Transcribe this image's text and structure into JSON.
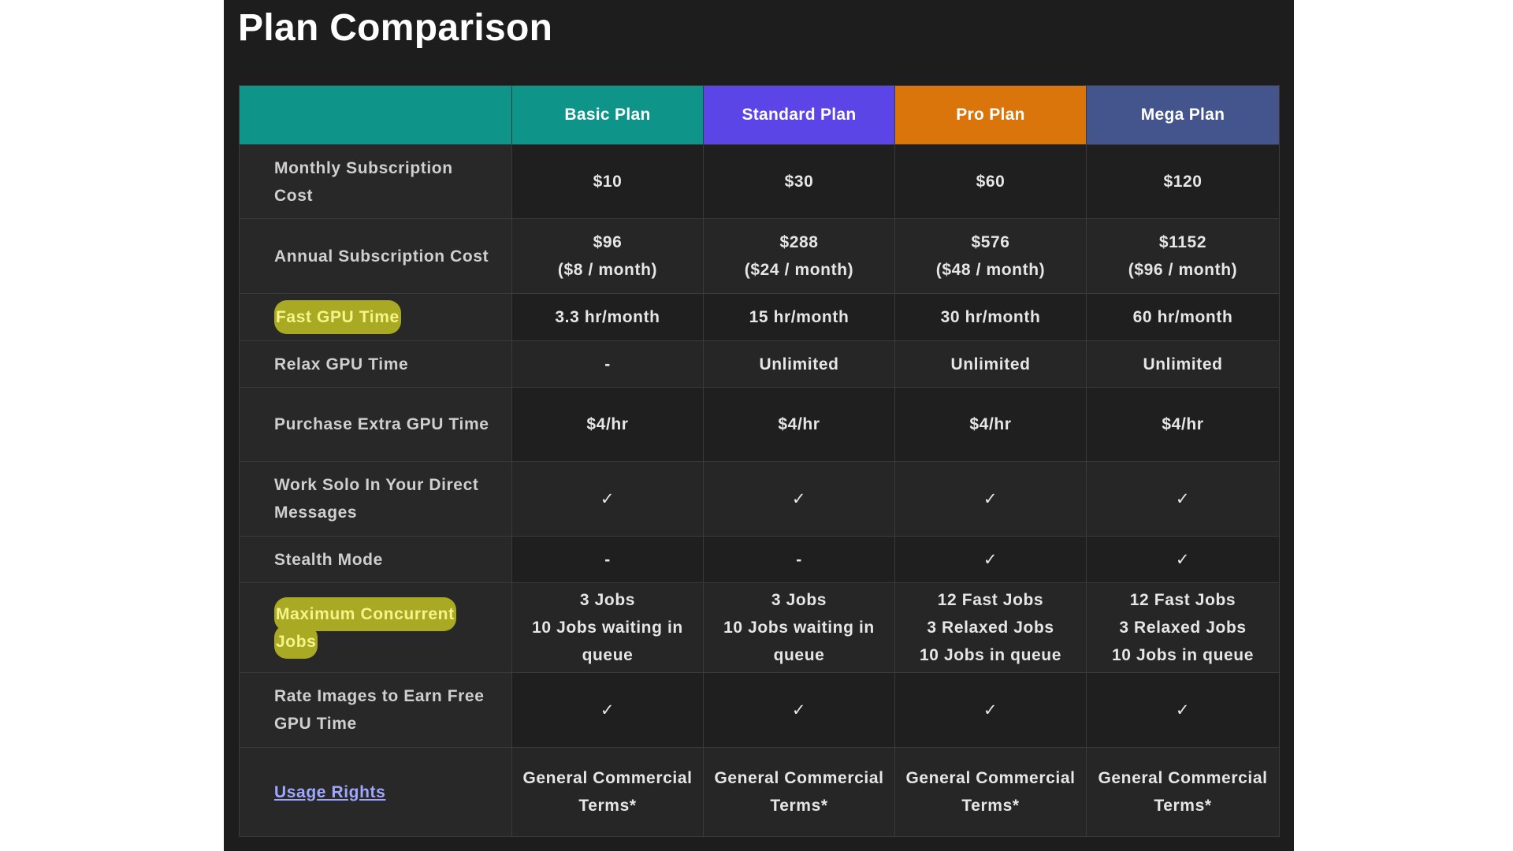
{
  "title": "Plan Comparison",
  "colors": {
    "basic": "#0e9488",
    "standard": "#5b45e6",
    "pro": "#d9750a",
    "mega": "#44548c",
    "highlight": "#a9a923"
  },
  "plans": [
    "Basic Plan",
    "Standard Plan",
    "Pro Plan",
    "Mega Plan"
  ],
  "rows": [
    {
      "label": "Monthly Subscription Cost",
      "values": [
        "$10",
        "$30",
        "$60",
        "$120"
      ]
    },
    {
      "label": "Annual Subscription Cost",
      "values": [
        "$96\n($8 / month)",
        "$288\n($24 / month)",
        "$576\n($48 / month)",
        "$1152\n($96 / month)"
      ]
    },
    {
      "label": "Fast GPU Time",
      "highlighted": true,
      "values": [
        "3.3 hr/month",
        "15 hr/month",
        "30 hr/month",
        "60 hr/month"
      ]
    },
    {
      "label": "Relax GPU Time",
      "values": [
        "-",
        "Unlimited",
        "Unlimited",
        "Unlimited"
      ]
    },
    {
      "label": "Purchase Extra GPU Time",
      "values": [
        "$4/hr",
        "$4/hr",
        "$4/hr",
        "$4/hr"
      ]
    },
    {
      "label": "Work Solo In Your Direct Messages",
      "values": [
        "✓",
        "✓",
        "✓",
        "✓"
      ]
    },
    {
      "label": "Stealth Mode",
      "values": [
        "-",
        "-",
        "✓",
        "✓"
      ]
    },
    {
      "label": "Maximum Concurrent Jobs",
      "highlighted": true,
      "values": [
        "3 Jobs\n10 Jobs waiting in queue",
        "3 Jobs\n10 Jobs waiting in queue",
        "12 Fast Jobs\n3 Relaxed Jobs\n10 Jobs in queue",
        "12 Fast Jobs\n3 Relaxed Jobs\n10 Jobs in queue"
      ]
    },
    {
      "label": "Rate Images to Earn Free GPU Time",
      "values": [
        "✓",
        "✓",
        "✓",
        "✓"
      ]
    },
    {
      "label": "Usage Rights",
      "link": true,
      "values": [
        "General Commercial Terms*",
        "General Commercial Terms*",
        "General Commercial Terms*",
        "General Commercial Terms*"
      ]
    }
  ]
}
